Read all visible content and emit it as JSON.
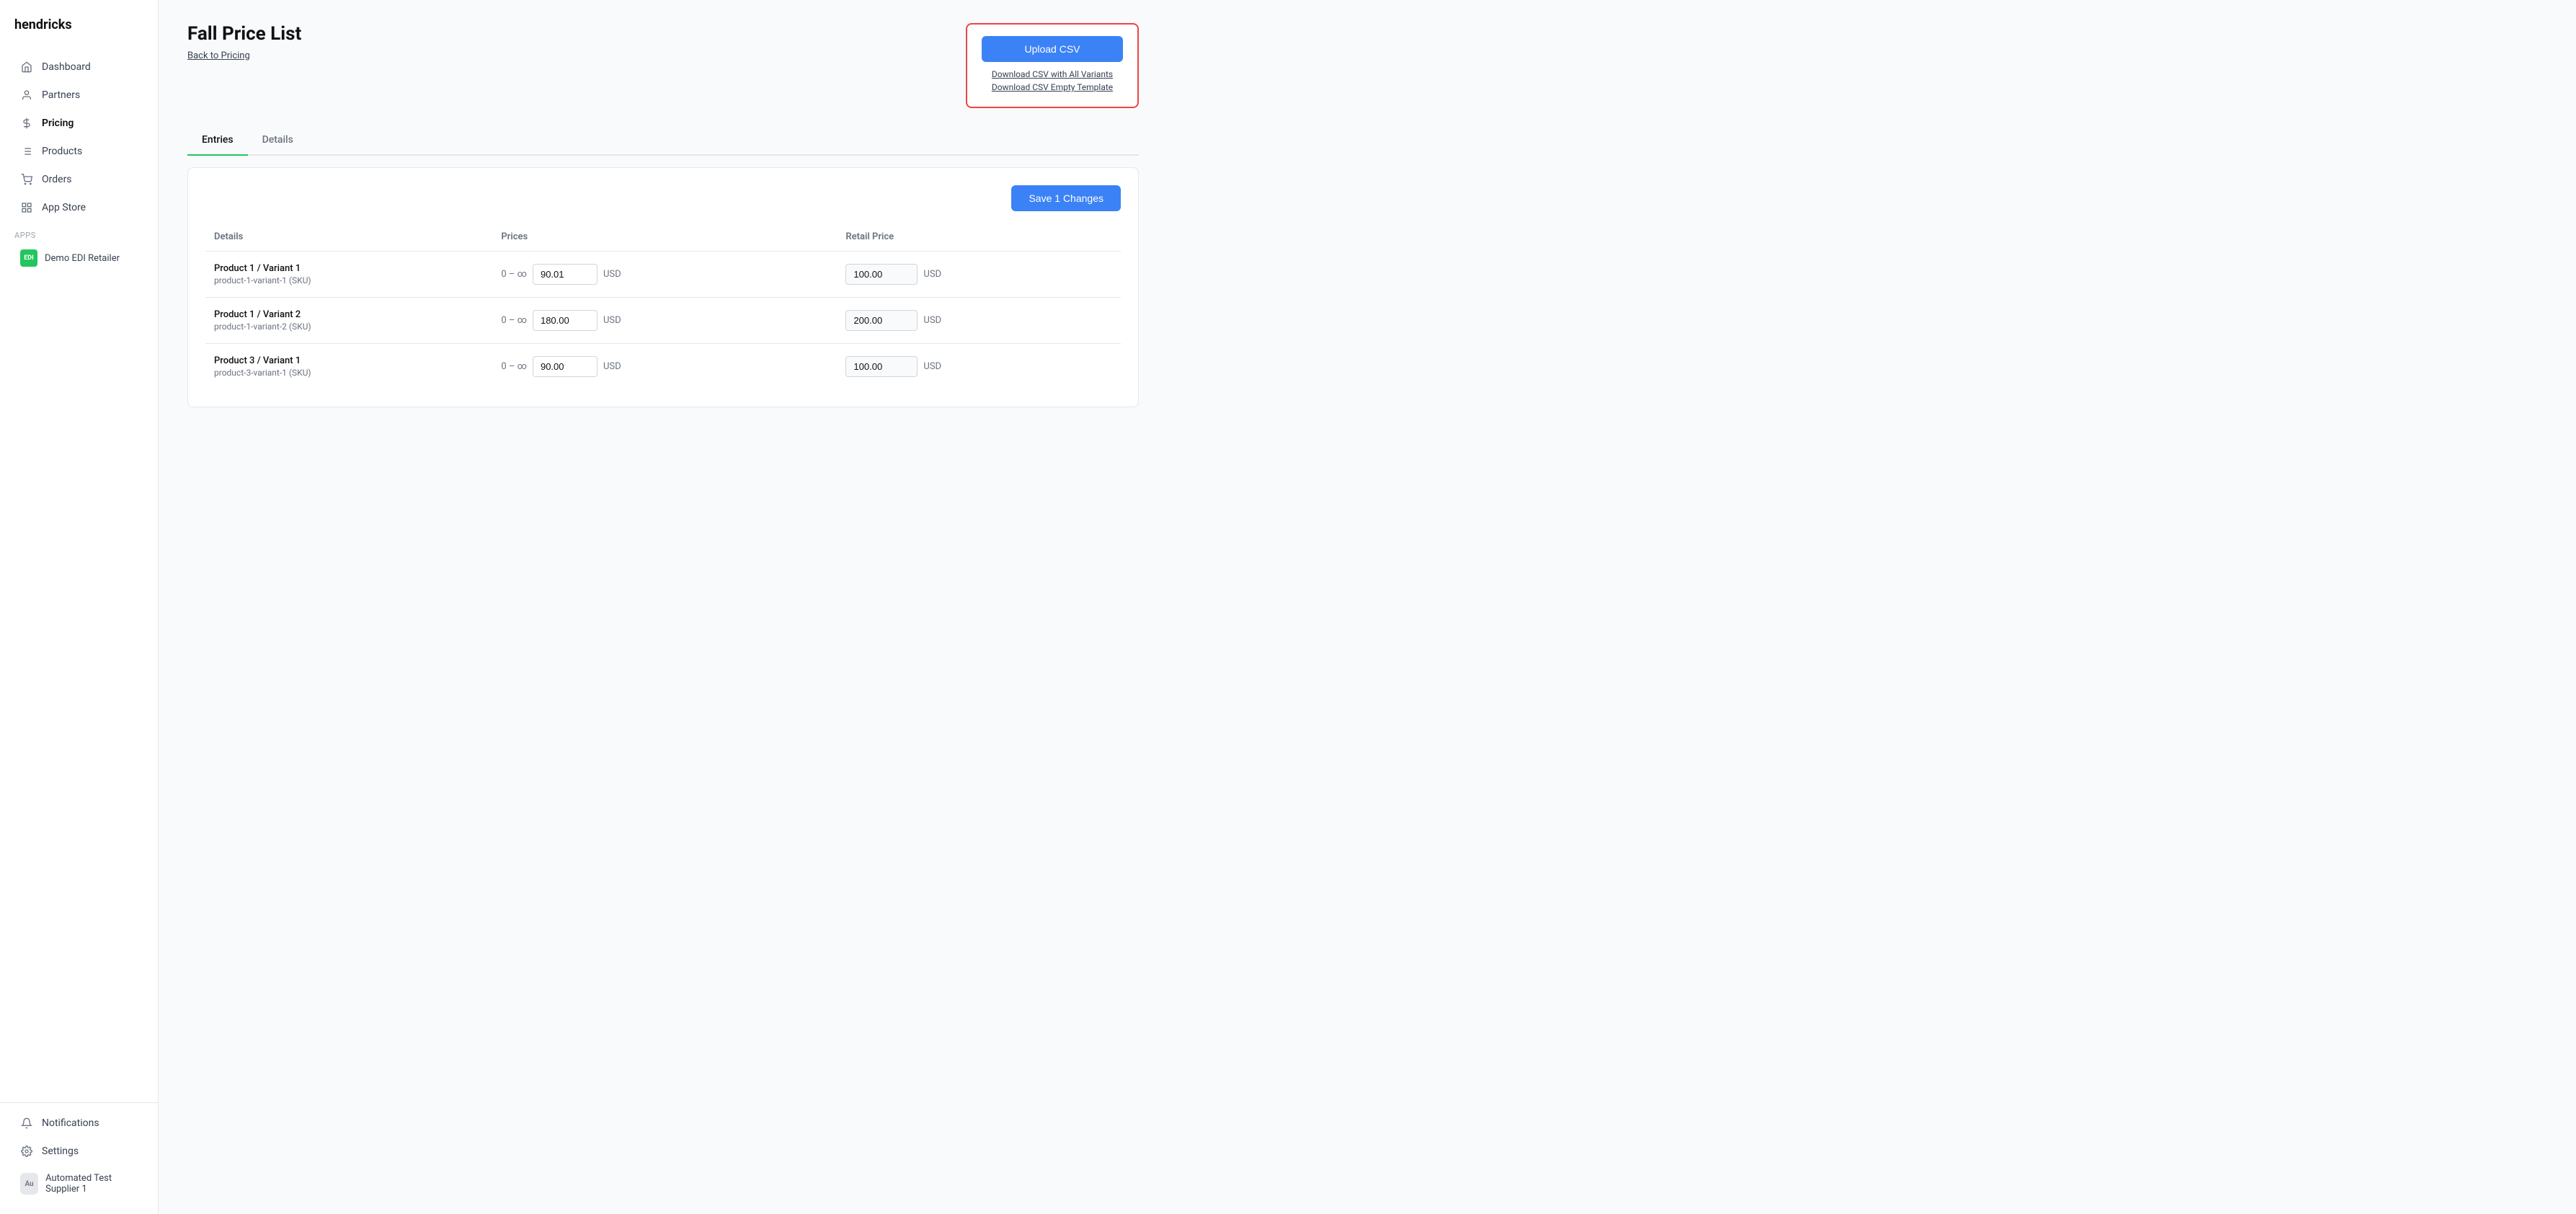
{
  "brand": "hendricks",
  "sidebar": {
    "nav_items": [
      {
        "id": "dashboard",
        "label": "Dashboard",
        "icon": "🏠"
      },
      {
        "id": "partners",
        "label": "Partners",
        "icon": "👤"
      },
      {
        "id": "pricing",
        "label": "Pricing",
        "icon": "$",
        "active": true
      },
      {
        "id": "products",
        "label": "Products",
        "icon": "☰"
      },
      {
        "id": "orders",
        "label": "Orders",
        "icon": "🛒"
      },
      {
        "id": "appstore",
        "label": "App Store",
        "icon": "⊞"
      }
    ],
    "apps_label": "Apps",
    "apps": [
      {
        "id": "demo-edi",
        "label": "Demo EDI Retailer",
        "avatar_text": "EDI",
        "avatar_color": "#22c55e"
      }
    ],
    "bottom_items": [
      {
        "id": "notifications",
        "label": "Notifications",
        "icon": "🔔"
      },
      {
        "id": "settings",
        "label": "Settings",
        "icon": "⚙"
      }
    ],
    "user": {
      "label": "Automated Test Supplier 1",
      "avatar_text": "Au"
    }
  },
  "page": {
    "title": "Fall Price List",
    "back_link": "Back to Pricing"
  },
  "upload_box": {
    "upload_btn_label": "Upload CSV",
    "link1_label": "Download CSV with All Variants",
    "link2_label": "Download CSV Empty Template"
  },
  "tabs": [
    {
      "id": "entries",
      "label": "Entries",
      "active": true
    },
    {
      "id": "details",
      "label": "Details",
      "active": false
    }
  ],
  "save_btn_label": "Save 1 Changes",
  "table": {
    "columns": [
      {
        "id": "details",
        "label": "Details"
      },
      {
        "id": "prices",
        "label": "Prices"
      },
      {
        "id": "retail_price",
        "label": "Retail Price"
      }
    ],
    "rows": [
      {
        "id": "row1",
        "product_name": "Product 1 / Variant 1",
        "product_sku": "product-1-variant-1 (SKU)",
        "range": "0 – ∞",
        "price": "90.01",
        "currency": "USD",
        "retail_price": "100.00",
        "retail_currency": "USD"
      },
      {
        "id": "row2",
        "product_name": "Product 1 / Variant 2",
        "product_sku": "product-1-variant-2 (SKU)",
        "range": "0 – ∞",
        "price": "180.00",
        "currency": "USD",
        "retail_price": "200.00",
        "retail_currency": "USD"
      },
      {
        "id": "row3",
        "product_name": "Product 3 / Variant 1",
        "product_sku": "product-3-variant-1 (SKU)",
        "range": "0 – ∞",
        "price": "90.00",
        "currency": "USD",
        "retail_price": "100.00",
        "retail_currency": "USD"
      }
    ]
  }
}
